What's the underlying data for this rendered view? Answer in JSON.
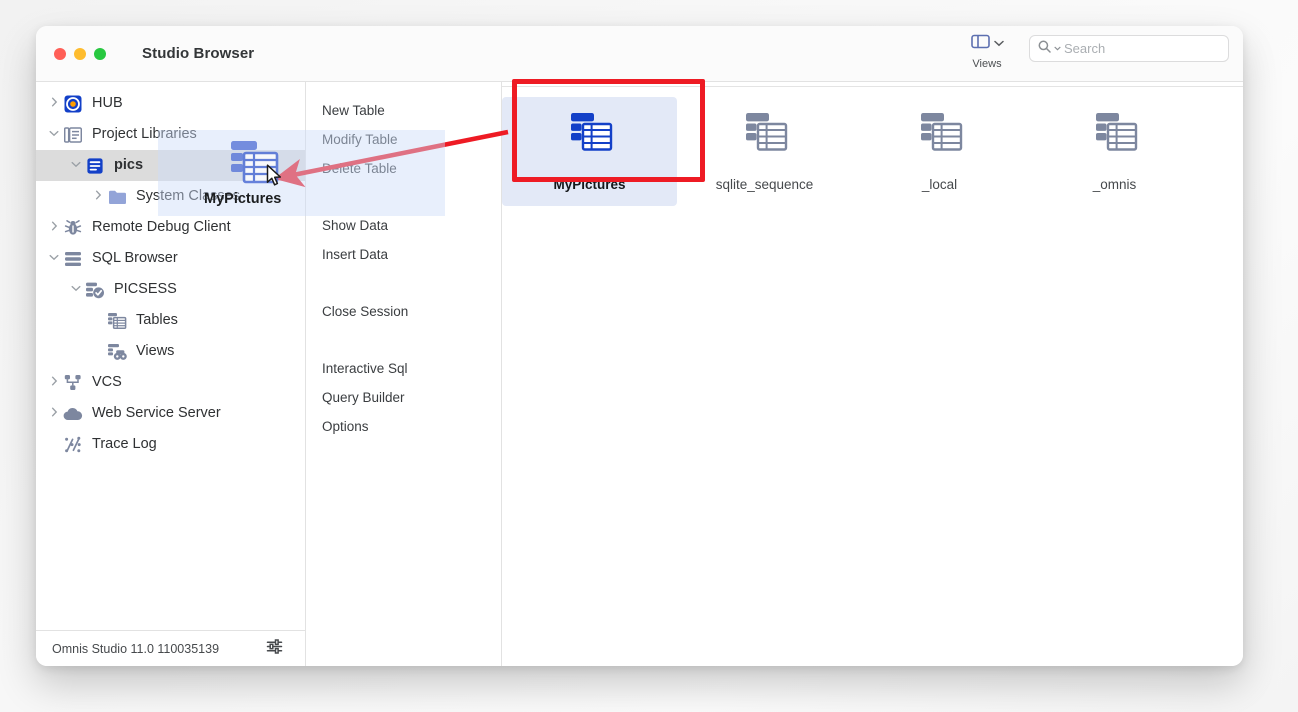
{
  "window": {
    "title": "Studio Browser",
    "traffic_lights": [
      "close-red",
      "minimize-yellow",
      "zoom-green"
    ]
  },
  "toolbar": {
    "views_label": "Views",
    "views_icon": "panel-layout-icon",
    "views_chevron": "chevron-down-icon",
    "search": {
      "placeholder": "Search",
      "value": "",
      "icon": "search-icon",
      "scope_chevron": "chevron-down-icon"
    }
  },
  "sidebar": {
    "items": [
      {
        "label": "HUB",
        "icon": "omnis-hub-icon",
        "twisty": "collapsed",
        "indent": 0,
        "selected": false
      },
      {
        "label": "Project Libraries",
        "icon": "libraries-icon",
        "twisty": "expanded",
        "indent": 0,
        "selected": false
      },
      {
        "label": "pics",
        "icon": "library-icon",
        "twisty": "expanded",
        "indent": 1,
        "selected": true
      },
      {
        "label": "System Classes",
        "icon": "folder-icon",
        "twisty": "collapsed",
        "indent": 2,
        "selected": false
      },
      {
        "label": "Remote Debug Client",
        "icon": "bug-icon",
        "twisty": "collapsed",
        "indent": 0,
        "selected": false
      },
      {
        "label": "SQL Browser",
        "icon": "sql-browser-icon",
        "twisty": "expanded",
        "indent": 0,
        "selected": false
      },
      {
        "label": "PICSESS",
        "icon": "session-connected-icon",
        "twisty": "expanded",
        "indent": 1,
        "selected": false
      },
      {
        "label": "Tables",
        "icon": "tables-icon",
        "twisty": "none",
        "indent": 2,
        "selected": false
      },
      {
        "label": "Views",
        "icon": "views-icon",
        "twisty": "none",
        "indent": 2,
        "selected": false
      },
      {
        "label": "VCS",
        "icon": "vcs-icon",
        "twisty": "collapsed",
        "indent": 0,
        "selected": false
      },
      {
        "label": "Web Service Server",
        "icon": "cloud-icon",
        "twisty": "collapsed",
        "indent": 0,
        "selected": false
      },
      {
        "label": "Trace Log",
        "icon": "trace-log-icon",
        "twisty": "none",
        "indent": 0,
        "selected": false
      }
    ]
  },
  "status_bar": {
    "text": "Omnis Studio 11.0 110035139",
    "icon": "preferences-sliders-icon"
  },
  "menu": {
    "groups": [
      {
        "items": [
          "New Table",
          "Modify Table",
          "Delete Table"
        ]
      },
      {
        "items": [
          "Show Data",
          "Insert Data"
        ]
      },
      {
        "items": [
          "Close Session"
        ]
      },
      {
        "items": [
          "Interactive Sql",
          "Query Builder",
          "Options"
        ]
      }
    ]
  },
  "main": {
    "tables": [
      {
        "label": "MyPictures",
        "icon": "table-icon",
        "selected": true
      },
      {
        "label": "sqlite_sequence",
        "icon": "table-icon",
        "selected": false
      },
      {
        "label": "_local",
        "icon": "table-icon",
        "selected": false
      },
      {
        "label": "_omnis",
        "icon": "table-icon",
        "selected": false
      }
    ]
  },
  "annotation": {
    "highlight_color": "#ee1b24",
    "arrow_icon": "arrow-pointer-annotation",
    "target_label": "MyPictures"
  },
  "drag": {
    "ghost_label": "MyPictures",
    "ghost_icon": "table-icon",
    "cursor_icon": "mouse-pointer-icon"
  },
  "colors": {
    "selection_blue": "#e3e9f7",
    "icon_blue": "#1340c8",
    "icon_gray": "#7d879f",
    "annotation_red": "#ee1b24"
  }
}
